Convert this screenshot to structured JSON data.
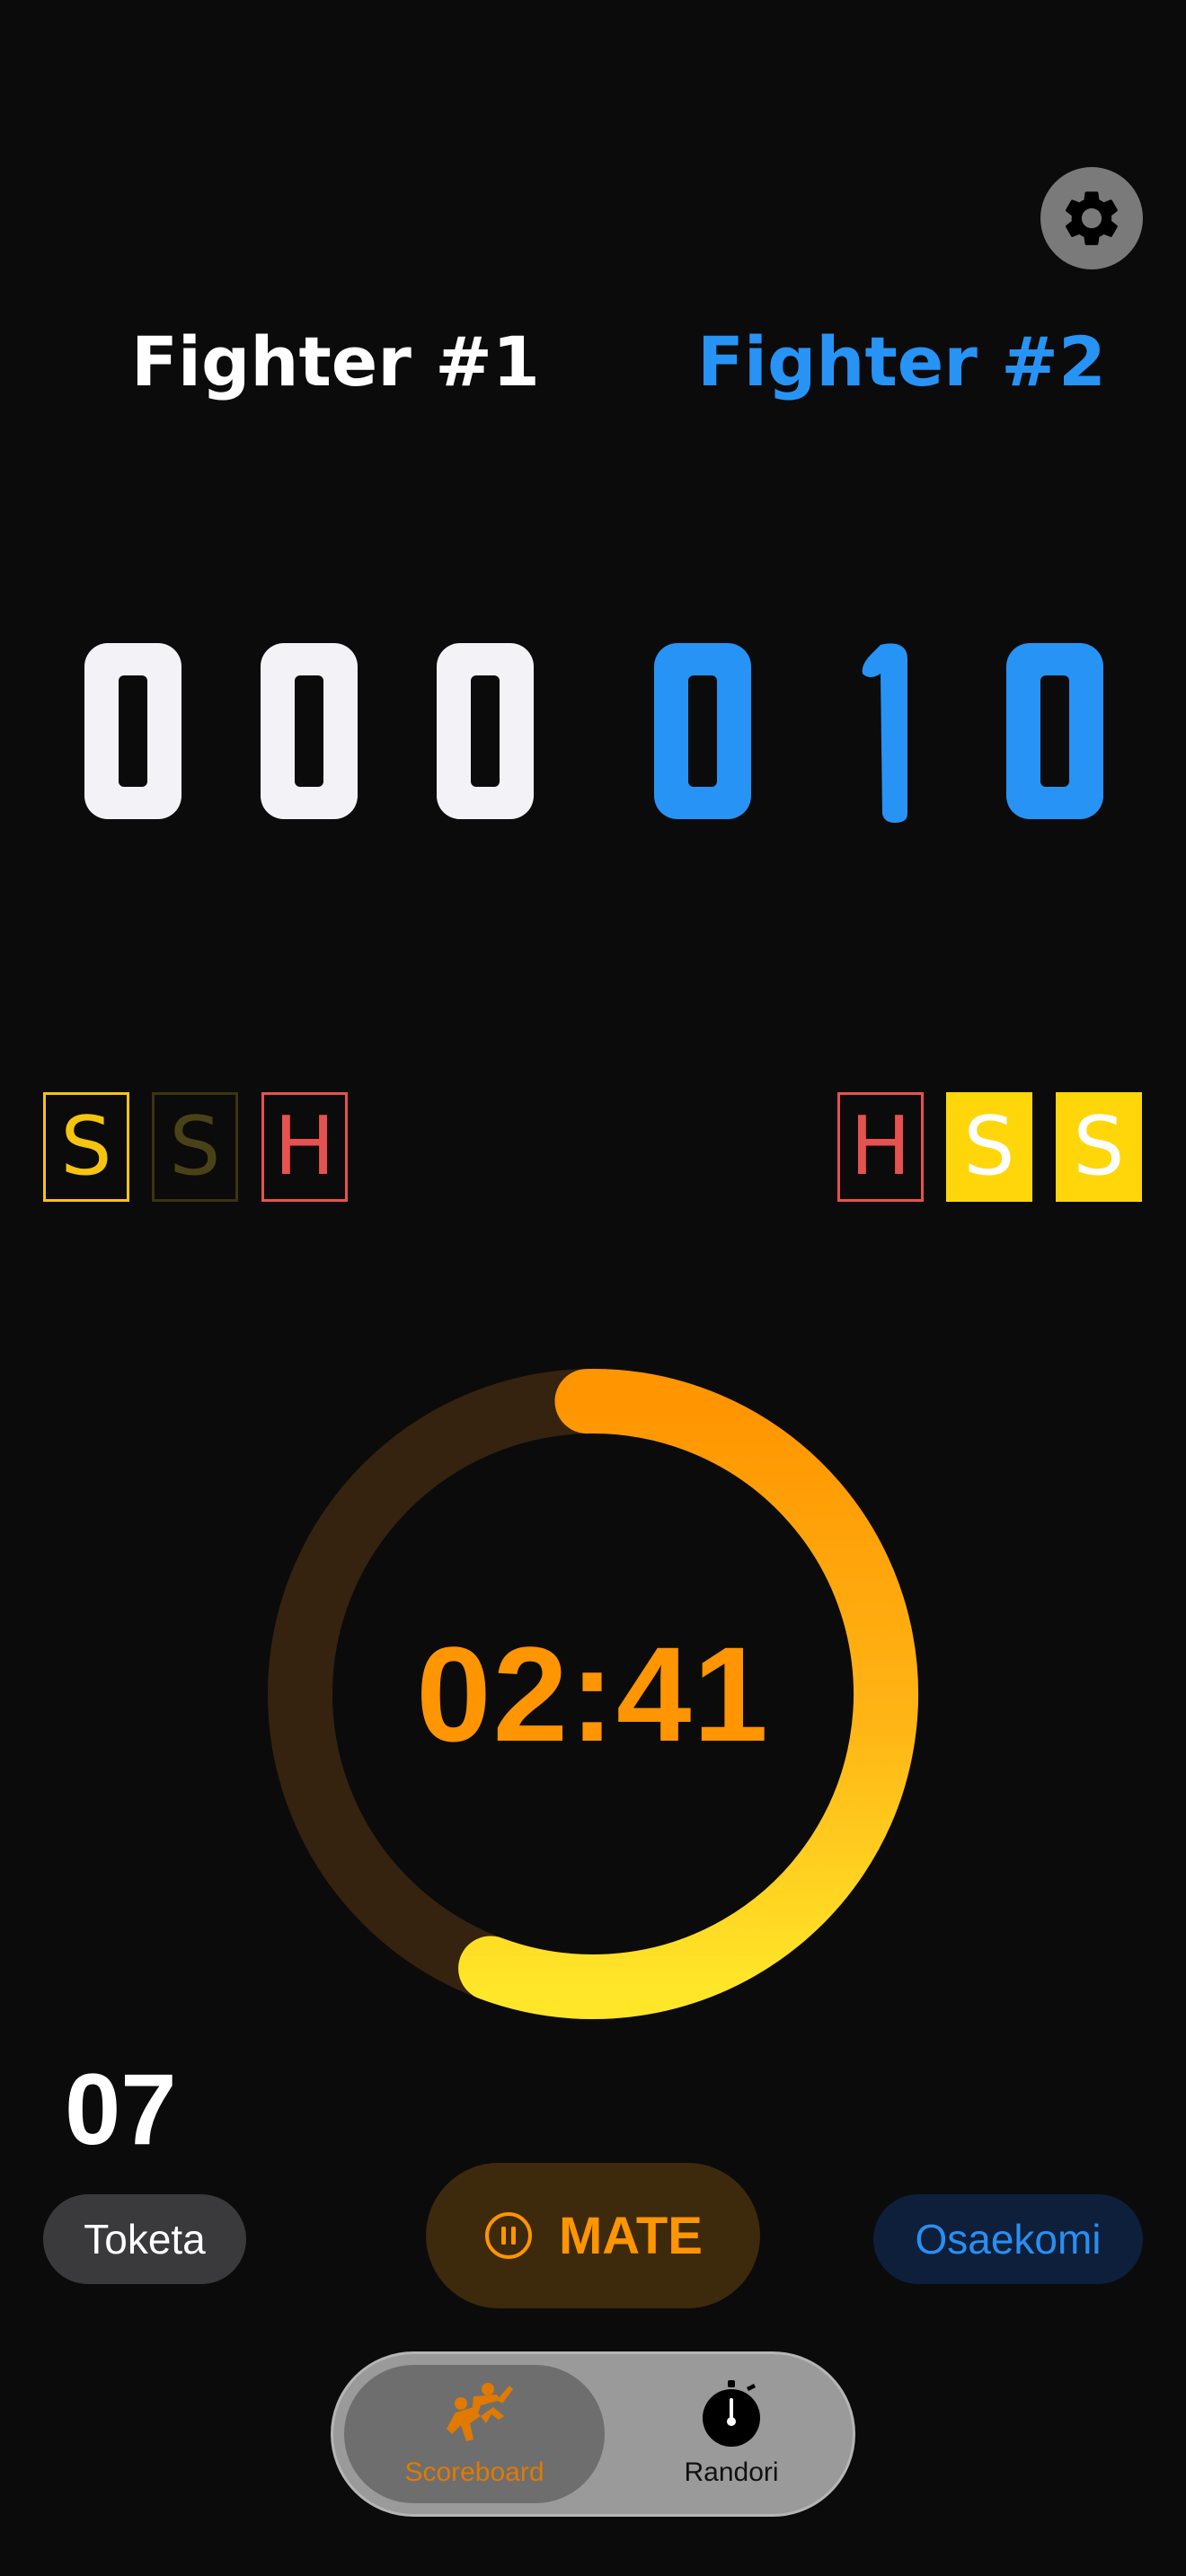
{
  "colors": {
    "background": "#0b0b0b",
    "fighter1": "#ffffff",
    "fighter2": "#2793f5",
    "shido": "#ffd60a",
    "hansoku": "#e5524f",
    "timer": "#ff9500"
  },
  "header": {
    "settings_icon": "gear-icon"
  },
  "fighters": [
    {
      "name": "Fighter #1",
      "ippon": "0",
      "wazaari": "0",
      "yuko": "0"
    },
    {
      "name": "Fighter #2",
      "ippon": "0",
      "wazaari": "1",
      "yuko": "0"
    }
  ],
  "penalties": {
    "fighter1": [
      {
        "label": "S",
        "state": "active-outline"
      },
      {
        "label": "S",
        "state": "inactive"
      },
      {
        "label": "H",
        "state": "outline"
      }
    ],
    "fighter2": [
      {
        "label": "H",
        "state": "outline"
      },
      {
        "label": "S",
        "state": "filled"
      },
      {
        "label": "S",
        "state": "filled"
      }
    ]
  },
  "timer": {
    "display": "02:41",
    "progress": 0.56
  },
  "osaekomi_counter": "07",
  "controls": {
    "toketa_label": "Toketa",
    "mate_label": "MATE",
    "mate_icon": "pause-circle-icon",
    "osaekomi_label": "Osaekomi"
  },
  "tabbar": {
    "tabs": [
      {
        "label": "Scoreboard",
        "icon": "judo-throw-icon",
        "selected": true
      },
      {
        "label": "Randori",
        "icon": "stopwatch-icon",
        "selected": false
      }
    ]
  }
}
